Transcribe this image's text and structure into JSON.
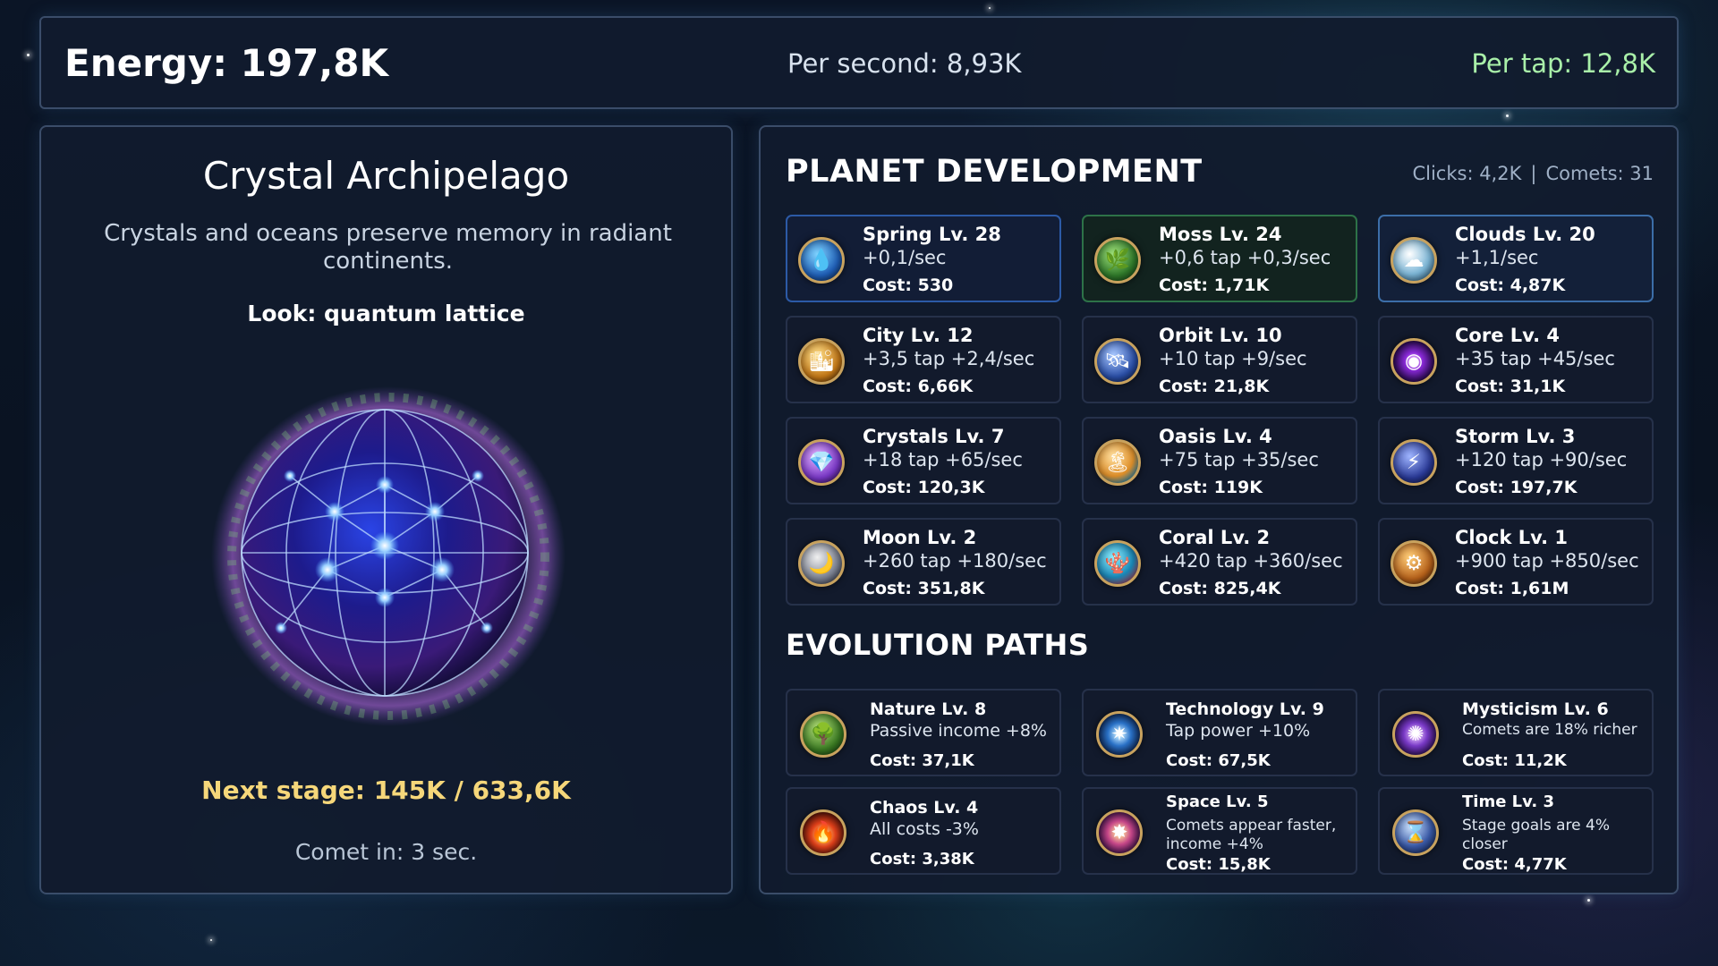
{
  "header": {
    "energy": "Energy: 197,8K",
    "per_second": "Per second: 8,93K",
    "per_tap": "Per tap: 12,8K"
  },
  "planet": {
    "name": "Crystal Archipelago",
    "description": "Crystals and oceans preserve memory in radiant continents.",
    "look": "Look: quantum lattice",
    "next_stage": "Next stage: 145K / 633,6K",
    "comet_in": "Comet in: 3 sec."
  },
  "development": {
    "title": "PLANET DEVELOPMENT",
    "clicks": "Clicks: 4,2K",
    "separator": "|",
    "comets": "Comets: 31",
    "items": [
      {
        "name": "Spring Lv. 28",
        "effect": "+0,1/sec",
        "cost": "Cost: 530",
        "icon": "water-drop-icon",
        "accent": "#2c5aa6"
      },
      {
        "name": "Moss Lv. 24",
        "effect": "+0,6 tap  +0,3/sec",
        "cost": "Cost: 1,71K",
        "icon": "leaf-icon",
        "accent": "#2d7248"
      },
      {
        "name": "Clouds Lv. 20",
        "effect": "+1,1/sec",
        "cost": "Cost: 4,87K",
        "icon": "cloud-icon",
        "accent": "#3c6ea8"
      },
      {
        "name": "City Lv. 12",
        "effect": "+3,5 tap  +2,4/sec",
        "cost": "Cost: 6,66K",
        "icon": "city-icon"
      },
      {
        "name": "Orbit Lv. 10",
        "effect": "+10 tap  +9/sec",
        "cost": "Cost: 21,8K",
        "icon": "satellite-icon"
      },
      {
        "name": "Core Lv. 4",
        "effect": "+35 tap  +45/sec",
        "cost": "Cost: 31,1K",
        "icon": "core-icon"
      },
      {
        "name": "Crystals Lv. 7",
        "effect": "+18 tap  +65/sec",
        "cost": "Cost: 120,3K",
        "icon": "crystal-icon"
      },
      {
        "name": "Oasis Lv. 4",
        "effect": "+75 tap  +35/sec",
        "cost": "Cost: 119K",
        "icon": "oasis-icon"
      },
      {
        "name": "Storm Lv. 3",
        "effect": "+120 tap  +90/sec",
        "cost": "Cost: 197,7K",
        "icon": "storm-icon"
      },
      {
        "name": "Moon Lv. 2",
        "effect": "+260 tap  +180/sec",
        "cost": "Cost: 351,8K",
        "icon": "moon-icon"
      },
      {
        "name": "Coral Lv. 2",
        "effect": "+420 tap  +360/sec",
        "cost": "Cost: 825,4K",
        "icon": "coral-icon"
      },
      {
        "name": "Clock Lv. 1",
        "effect": "+900 tap  +850/sec",
        "cost": "Cost: 1,61M",
        "icon": "clock-icon"
      }
    ]
  },
  "evolution": {
    "title": "EVOLUTION PATHS",
    "items": [
      {
        "name": "Nature Lv. 8",
        "effect": "Passive income +8%",
        "cost": "Cost: 37,1K",
        "icon": "nature-icon"
      },
      {
        "name": "Technology Lv. 9",
        "effect": "Tap power +10%",
        "cost": "Cost: 67,5K",
        "icon": "technology-icon"
      },
      {
        "name": "Mysticism Lv. 6",
        "effect": "Comets are 18% richer",
        "cost": "Cost: 11,2K",
        "icon": "mysticism-icon"
      },
      {
        "name": "Chaos Lv. 4",
        "effect": "All costs -3%",
        "cost": "Cost: 3,38K",
        "icon": "chaos-icon"
      },
      {
        "name": "Space Lv. 5",
        "effect": "Comets appear faster, income +4%",
        "cost": "Cost: 15,8K",
        "icon": "space-icon"
      },
      {
        "name": "Time Lv. 3",
        "effect": "Stage goals are 4% closer",
        "cost": "Cost: 4,77K",
        "icon": "time-icon"
      }
    ]
  }
}
